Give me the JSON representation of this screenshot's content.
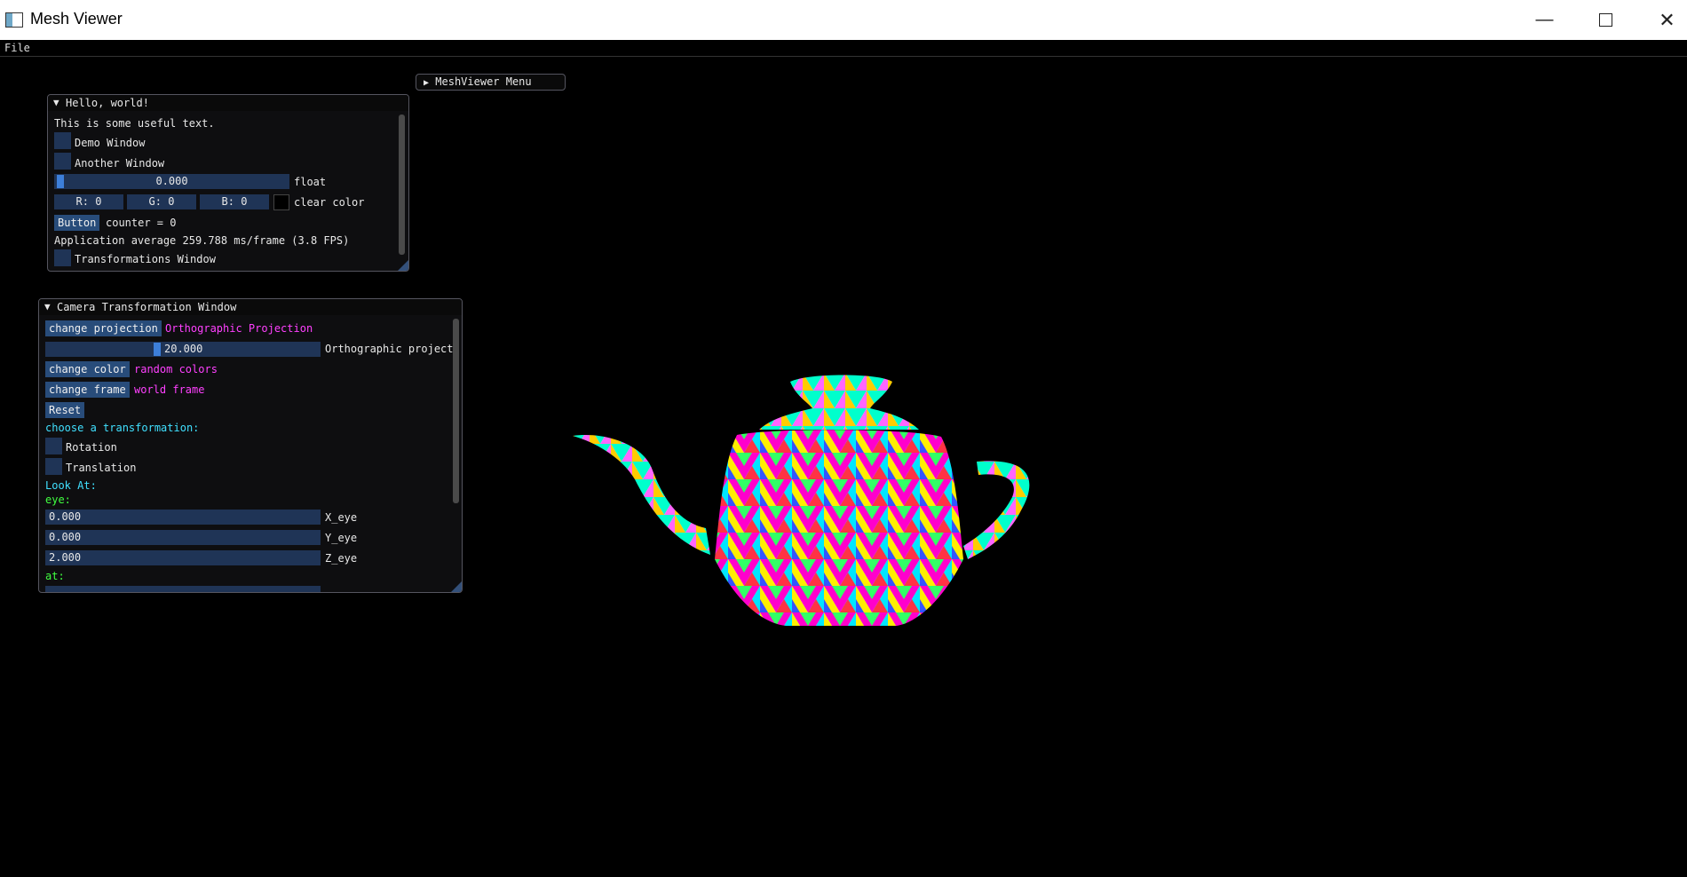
{
  "window": {
    "title": "Mesh Viewer"
  },
  "menubar": {
    "file": "File"
  },
  "meshviewer_menu": {
    "label": "MeshViewer Menu"
  },
  "hello": {
    "title": "Hello, world!",
    "text": "This is some useful text.",
    "demo_window": "Demo Window",
    "another_window": "Another Window",
    "float_value": "0.000",
    "float_label": "float",
    "color_r": "R:  0",
    "color_g": "G:  0",
    "color_b": "B:  0",
    "clear_color_label": "clear color",
    "button_label": "Button",
    "counter_text": "counter = 0",
    "framerate_text": "Application average 259.788 ms/frame (3.8 FPS)",
    "transformations_window": "Transformations Window"
  },
  "camera": {
    "title": "Camera Transformation Window",
    "change_projection": "change projection",
    "projection_value": "Orthographic Projection",
    "ortho_value": "20.000",
    "ortho_label": "Orthographic project",
    "change_color": "change color",
    "color_value": "random colors",
    "change_frame": "change frame",
    "frame_value": "world frame",
    "reset": "Reset",
    "choose_transformation": "choose a transformation:",
    "rotation": "Rotation",
    "translation": "Translation",
    "look_at": "Look At:",
    "eye": "eye:",
    "x_eye_value": "0.000",
    "x_eye_label": "X_eye",
    "y_eye_value": "0.000",
    "y_eye_label": "Y_eye",
    "z_eye_value": "2.000",
    "z_eye_label": "Z_eye",
    "at": "at:"
  },
  "colors": {
    "accent": "#3d7fd9",
    "frame_bg": "#1f3456",
    "button_bg": "#284c7a",
    "magenta_text": "#ff40ff",
    "cyan_text": "#40e0ff",
    "green_text": "#40ff40"
  }
}
